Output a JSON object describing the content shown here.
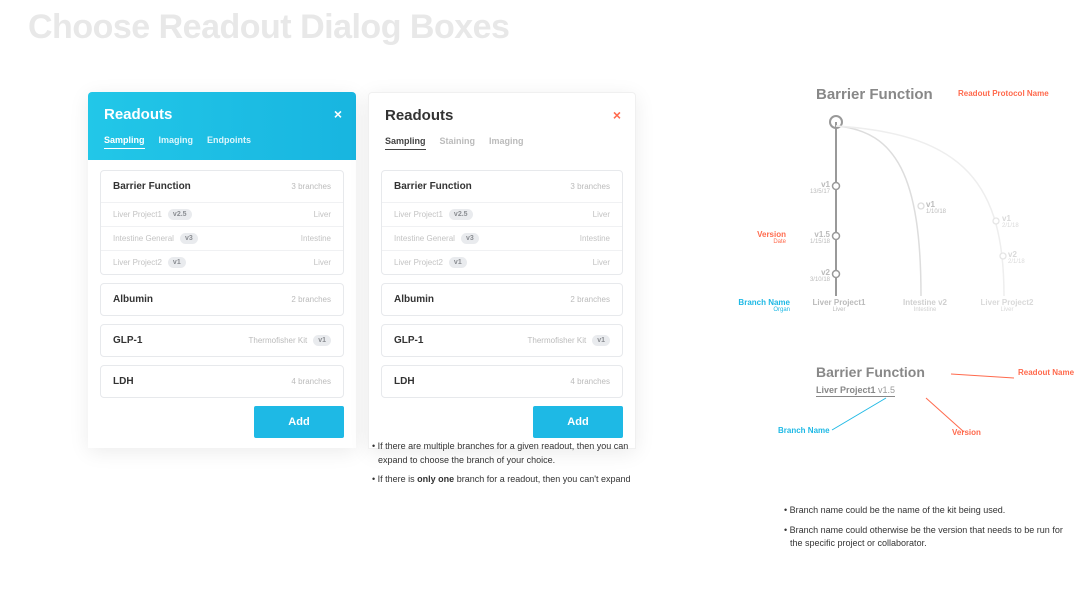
{
  "page_title": "Choose Readout Dialog Boxes",
  "dialog_blue": {
    "title": "Readouts",
    "close": "×",
    "tabs": [
      "Sampling",
      "Imaging",
      "Endpoints"
    ],
    "active_tab": 0,
    "items": [
      {
        "name": "Barrier Function",
        "sub": "3 branches",
        "expanded": true,
        "branches": [
          {
            "name": "Liver Project1",
            "badge": "v2.5",
            "organ": "Liver"
          },
          {
            "name": "Intestine General",
            "badge": "v3",
            "organ": "Intestine"
          },
          {
            "name": "Liver Project2",
            "badge": "v1",
            "organ": "Liver"
          }
        ]
      },
      {
        "name": "Albumin",
        "sub": "2 branches"
      },
      {
        "name": "GLP-1",
        "sub": "Thermofisher Kit",
        "badge": "v1"
      },
      {
        "name": "LDH",
        "sub": "4 branches"
      }
    ],
    "add_label": "Add"
  },
  "dialog_white": {
    "title": "Readouts",
    "close": "×",
    "tabs": [
      "Sampling",
      "Staining",
      "Imaging"
    ],
    "active_tab": 0,
    "items": [
      {
        "name": "Barrier Function",
        "sub": "3 branches",
        "expanded": true,
        "branches": [
          {
            "name": "Liver Project1",
            "badge": "v2.5",
            "organ": "Liver"
          },
          {
            "name": "Intestine General",
            "badge": "v3",
            "organ": "Intestine"
          },
          {
            "name": "Liver Project2",
            "badge": "v1",
            "organ": "Liver"
          }
        ]
      },
      {
        "name": "Albumin",
        "sub": "2 branches"
      },
      {
        "name": "GLP-1",
        "sub": "Thermofisher Kit",
        "badge": "v1"
      },
      {
        "name": "LDH",
        "sub": "4 branches"
      }
    ],
    "add_label": "Add"
  },
  "notes_left": [
    "• If there are multiple branches for a given readout, then you can expand to choose the branch of your choice.",
    "• If there is only one branch for a readout, then you can't expand"
  ],
  "diagram": {
    "title": "Barrier Function",
    "protocol_label": "Readout Protocol Name",
    "versions": [
      {
        "label": "v1",
        "date": "13/5/17"
      },
      {
        "label": "v1.5",
        "date": "1/15/18"
      },
      {
        "label": "v2",
        "date": "3/10/18"
      }
    ],
    "version_label": "Version",
    "version_sublabel": "Date",
    "branch_label": "Branch Name",
    "branch_sublabel": "Organ",
    "branches": [
      {
        "name": "Liver Project1",
        "organ": "Liver"
      },
      {
        "name": "Intestine v2",
        "organ": "Intestine"
      },
      {
        "name": "Liver Project2",
        "organ": "Liver"
      }
    ],
    "side_versions": [
      {
        "label": "v1",
        "date": "1/10/18"
      },
      {
        "label": "v1",
        "date": "2/1/18"
      },
      {
        "label": "v2",
        "date": "2/1/18"
      }
    ]
  },
  "breadcrumb": {
    "title": "Barrier Function",
    "path_branch": "Liver Project1",
    "path_version": "v1.5",
    "labels": {
      "readout": "Readout Name",
      "branch": "Branch Name",
      "version": "Version"
    }
  },
  "notes_right": [
    "• Branch name could be the name of the kit being used.",
    "• Branch name could otherwise be the version that needs to be run for the specific project or collaborator."
  ]
}
